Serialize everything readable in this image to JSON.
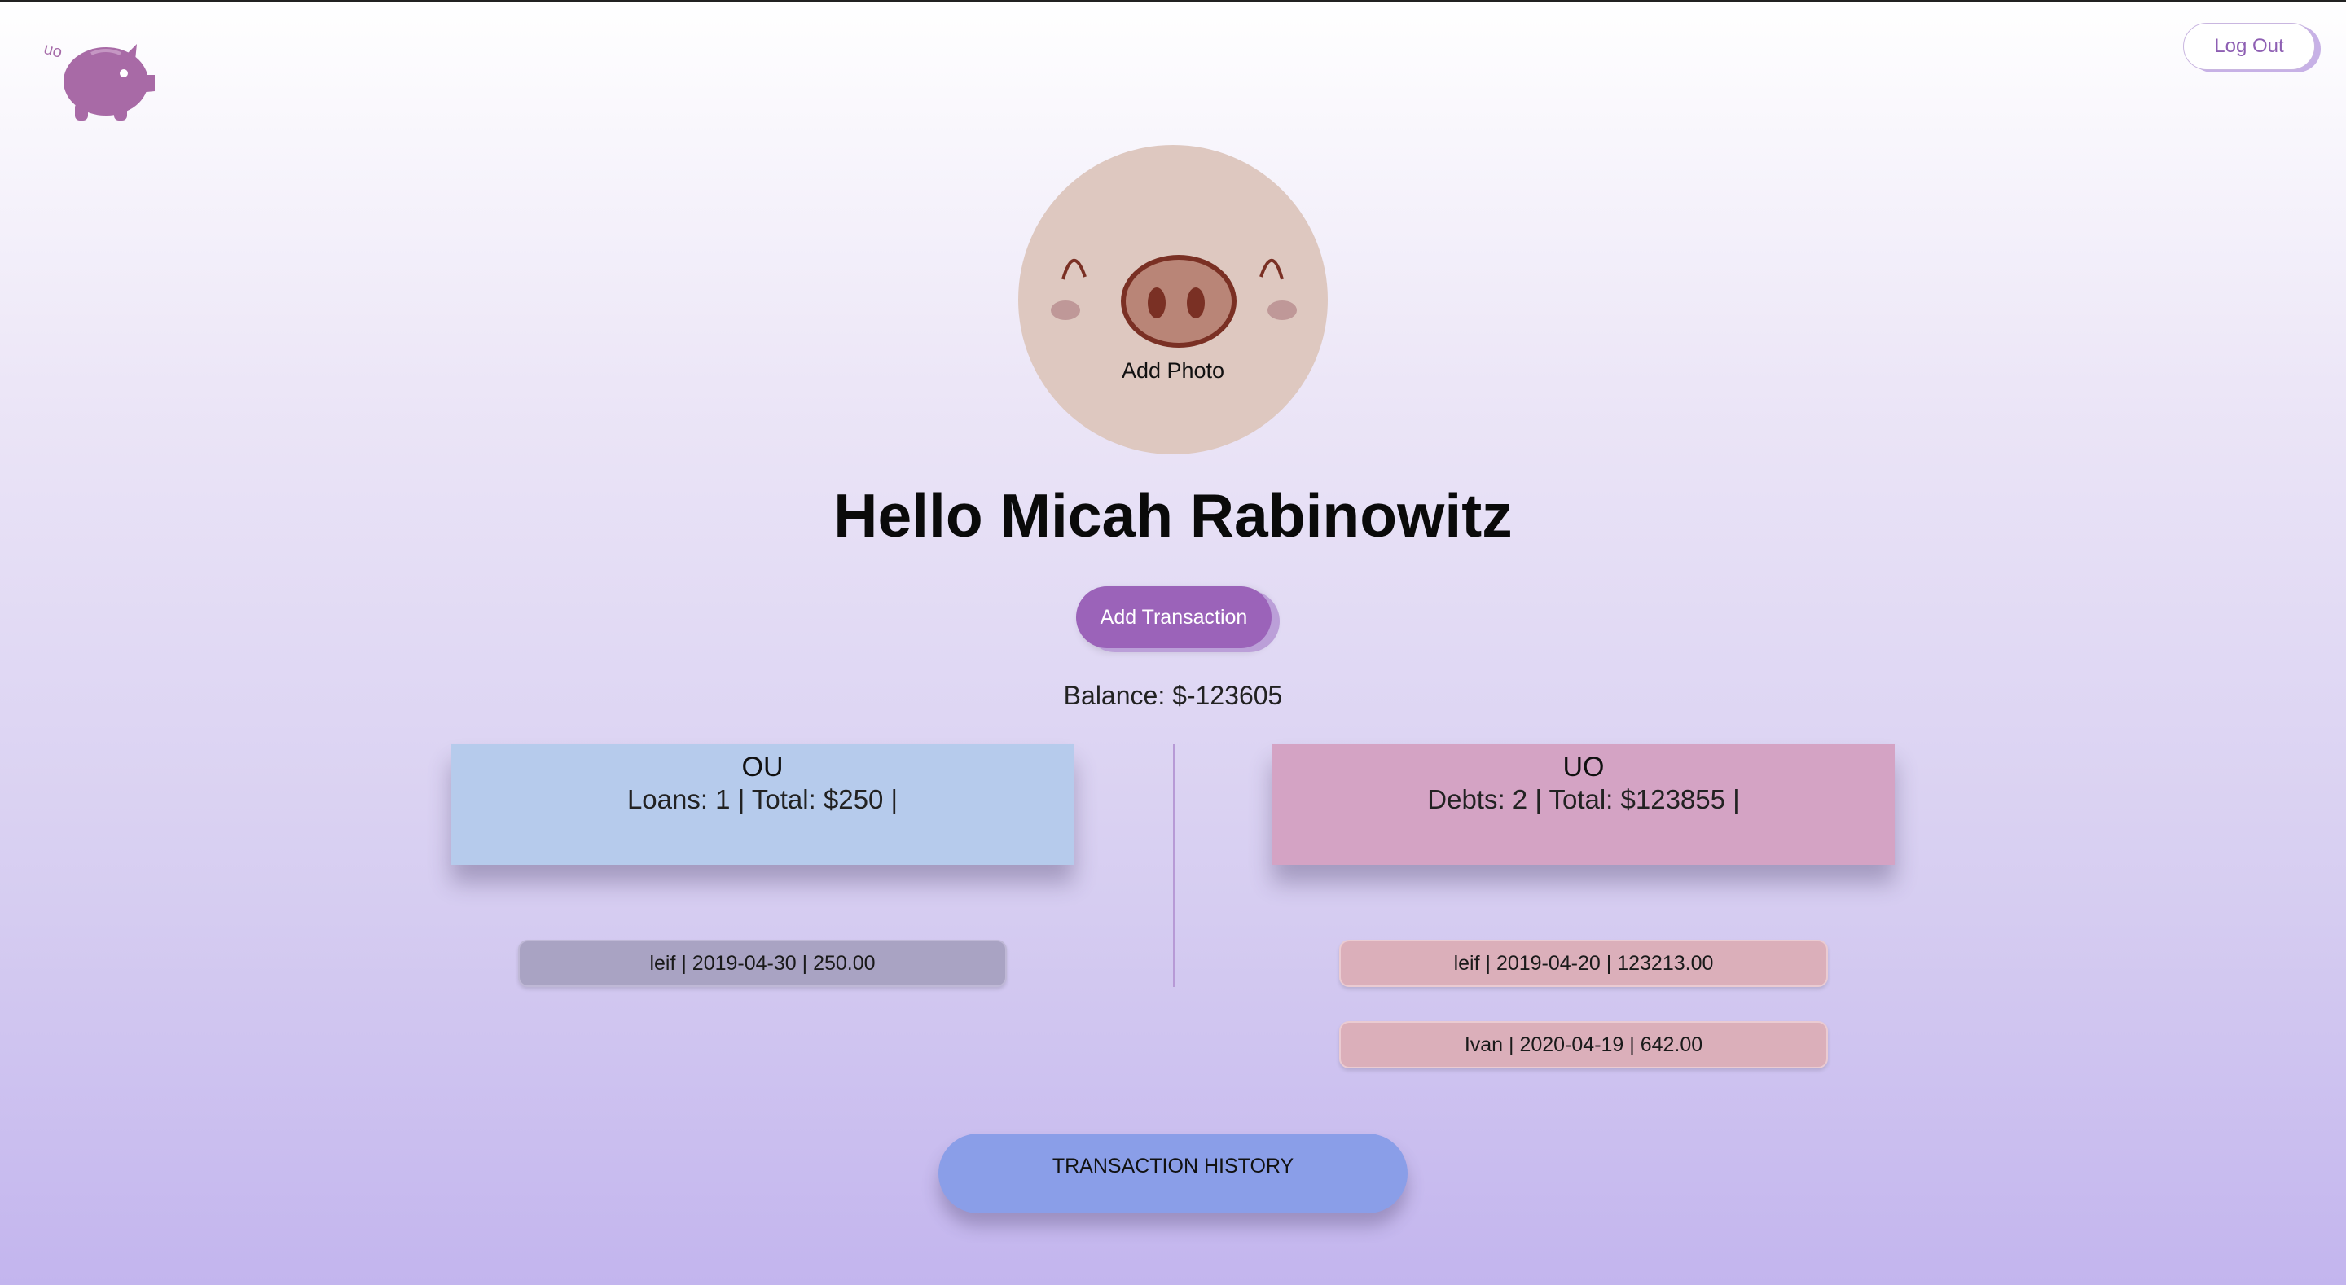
{
  "header": {
    "logout_label": "Log Out"
  },
  "profile": {
    "add_photo_label": "Add Photo",
    "greeting": "Hello Micah Rabinowitz"
  },
  "actions": {
    "add_transaction_label": "Add Transaction",
    "transaction_history_label": "TRANSACTION HISTORY"
  },
  "balance": "Balance: $-123605",
  "ou": {
    "title": "OU",
    "stats": "Loans: 1 | Total: $250 |",
    "transactions": [
      "leif | 2019-04-30 | 250.00"
    ]
  },
  "uo": {
    "title": "UO",
    "stats": "Debts: 2 | Total: $123855 |",
    "transactions": [
      "leif | 2019-04-20 | 123213.00",
      "Ivan | 2020-04-19 | 642.00"
    ]
  },
  "colors": {
    "accent_purple": "#9b63b9",
    "ou_card": "#b6cbec",
    "uo_card": "#d4a3c4",
    "history_button": "#8a9ee8"
  },
  "icons": {
    "logo": "piggy-bank-logo",
    "avatar": "pig-face-avatar"
  }
}
